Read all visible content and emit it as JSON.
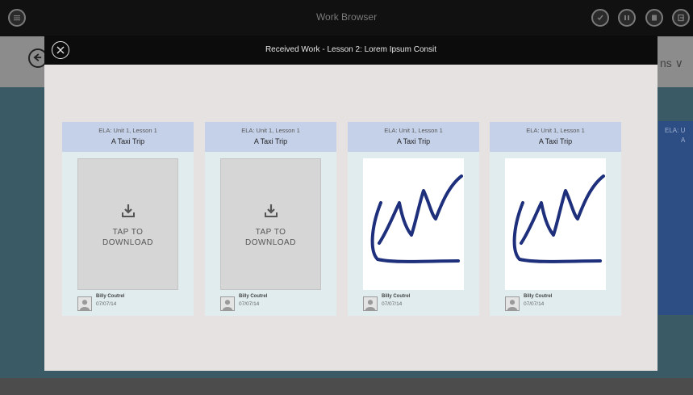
{
  "app": {
    "title": "Work Browser",
    "subbar_text": "ns ∨"
  },
  "top_icons": [
    "menu-icon",
    "check-icon",
    "library-icon",
    "clipboard-icon",
    "export-icon"
  ],
  "modal": {
    "title": "Received Work - Lesson 2: Lorem Ipsum Consit"
  },
  "cards": [
    {
      "unit": "ELA: Unit 1, Lesson 1",
      "lesson": "A Taxi Trip",
      "state": "download",
      "tap_line1": "TAP TO",
      "tap_line2": "DOWNLOAD",
      "user": "Billy Coutrel",
      "date": "07/07/14"
    },
    {
      "unit": "ELA: Unit 1, Lesson 1",
      "lesson": "A Taxi Trip",
      "state": "download",
      "tap_line1": "TAP TO",
      "tap_line2": "DOWNLOAD",
      "user": "Billy Coutrel",
      "date": "07/07/14"
    },
    {
      "unit": "ELA: Unit 1, Lesson 1",
      "lesson": "A Taxi Trip",
      "state": "drawing",
      "user": "Billy Coutrel",
      "date": "07/07/14"
    },
    {
      "unit": "ELA: Unit 1, Lesson 1",
      "lesson": "A Taxi Trip",
      "state": "drawing",
      "user": "Billy Coutrel",
      "date": "07/07/14"
    }
  ],
  "partial_card": {
    "unit": "ELA: U",
    "lesson": "A"
  },
  "colors": {
    "card_header": "#c5d1e9",
    "card_body": "#e0ecee",
    "drawing_stroke": "#1e2f7c",
    "modal_bg": "#e6e2e2"
  }
}
